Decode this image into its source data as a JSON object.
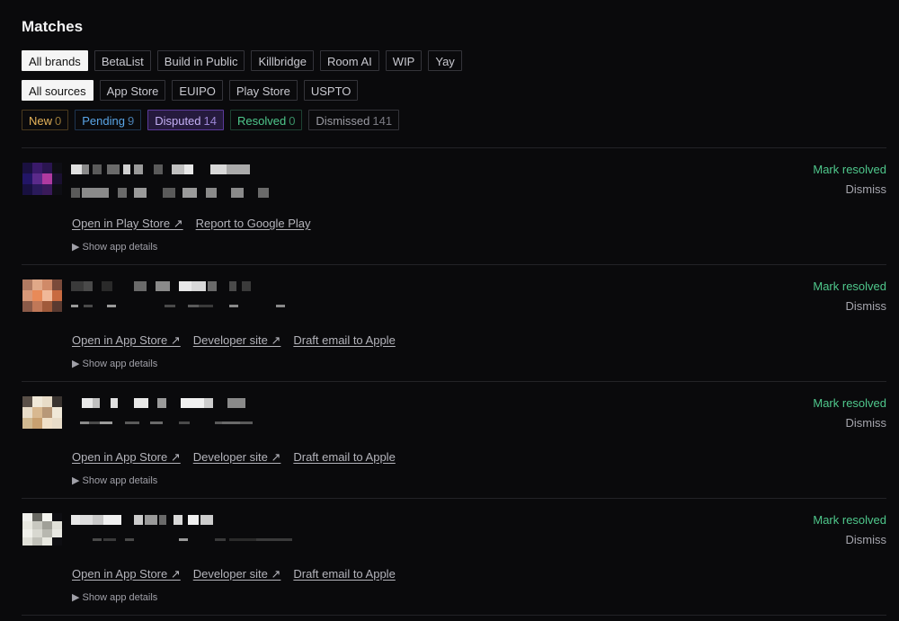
{
  "page": {
    "title": "Matches"
  },
  "brands": [
    "All brands",
    "BetaList",
    "Build in Public",
    "Killbridge",
    "Room AI",
    "WIP",
    "Yay"
  ],
  "sources": [
    "All sources",
    "App Store",
    "EUIPO",
    "Play Store",
    "USPTO"
  ],
  "statuses": [
    {
      "label": "New",
      "count": "0"
    },
    {
      "label": "Pending",
      "count": "9"
    },
    {
      "label": "Disputed",
      "count": "14"
    },
    {
      "label": "Resolved",
      "count": "0"
    },
    {
      "label": "Dismissed",
      "count": "141"
    }
  ],
  "matches": [
    {
      "links": [
        "Open in Play Store ↗",
        "Report to Google Play"
      ],
      "details": "▶ Show app details",
      "resolve": "Mark resolved",
      "dismiss": "Dismiss"
    },
    {
      "links": [
        "Open in App Store ↗",
        "Developer site ↗",
        "Draft email to Apple"
      ],
      "details": "▶ Show app details",
      "resolve": "Mark resolved",
      "dismiss": "Dismiss"
    },
    {
      "links": [
        "Open in App Store ↗",
        "Developer site ↗",
        "Draft email to Apple"
      ],
      "details": "▶ Show app details",
      "resolve": "Mark resolved",
      "dismiss": "Dismiss"
    },
    {
      "links": [
        "Open in App Store ↗",
        "Developer site ↗",
        "Draft email to Apple"
      ],
      "details": "▶ Show app details",
      "resolve": "Mark resolved",
      "dismiss": "Dismiss"
    }
  ]
}
